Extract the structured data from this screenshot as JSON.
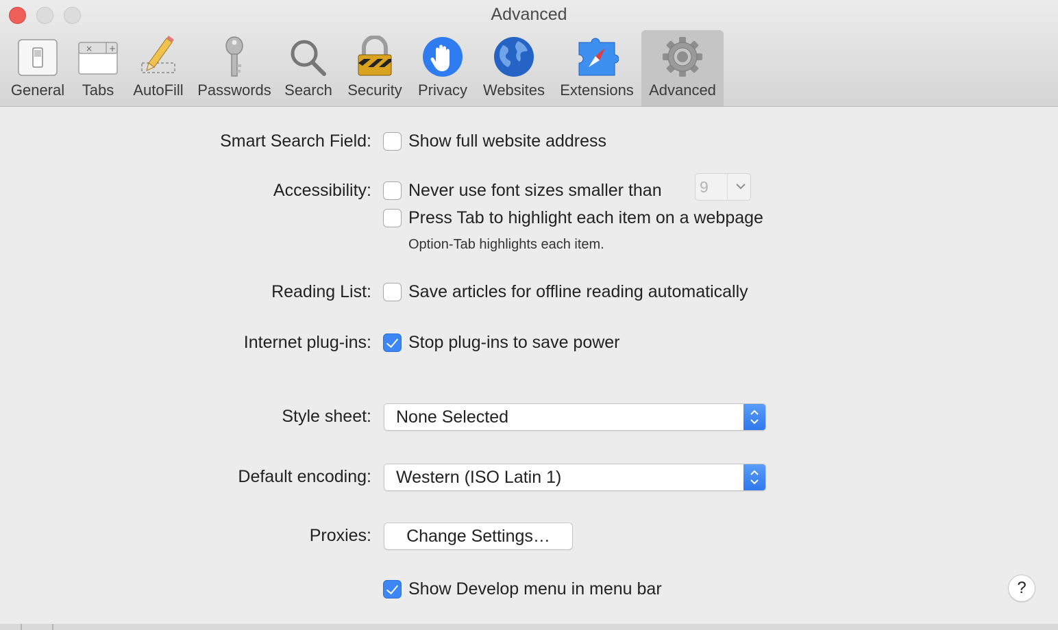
{
  "window": {
    "title": "Advanced"
  },
  "toolbar": {
    "tabs": [
      {
        "label": "General",
        "icon": "light-switch-icon"
      },
      {
        "label": "Tabs",
        "icon": "tabs-icon"
      },
      {
        "label": "AutoFill",
        "icon": "pencil-icon"
      },
      {
        "label": "Passwords",
        "icon": "key-icon"
      },
      {
        "label": "Search",
        "icon": "magnifier-icon"
      },
      {
        "label": "Security",
        "icon": "padlock-icon"
      },
      {
        "label": "Privacy",
        "icon": "hand-icon"
      },
      {
        "label": "Websites",
        "icon": "globe-icon"
      },
      {
        "label": "Extensions",
        "icon": "puzzle-compass-icon"
      },
      {
        "label": "Advanced",
        "icon": "gear-icon",
        "selected": true
      }
    ]
  },
  "settings": {
    "smart_search": {
      "label": "Smart Search Field:",
      "option": "Show full website address",
      "checked": false
    },
    "accessibility": {
      "label": "Accessibility:",
      "font_size_option": "Never use font sizes smaller than",
      "font_size_checked": false,
      "font_size_value": "9",
      "tab_option": "Press Tab to highlight each item on a webpage",
      "tab_checked": false,
      "tab_hint": "Option-Tab highlights each item."
    },
    "reading_list": {
      "label": "Reading List:",
      "option": "Save articles for offline reading automatically",
      "checked": false
    },
    "plugins": {
      "label": "Internet plug-ins:",
      "option": "Stop plug-ins to save power",
      "checked": true
    },
    "style_sheet": {
      "label": "Style sheet:",
      "value": "None Selected"
    },
    "encoding": {
      "label": "Default encoding:",
      "value": "Western (ISO Latin 1)"
    },
    "proxies": {
      "label": "Proxies:",
      "button": "Change Settings…"
    },
    "develop_menu": {
      "option": "Show Develop menu in menu bar",
      "checked": true
    }
  },
  "help": {
    "label": "?"
  },
  "colors": {
    "accent": "#3c87f5",
    "close": "#ee5f58"
  }
}
